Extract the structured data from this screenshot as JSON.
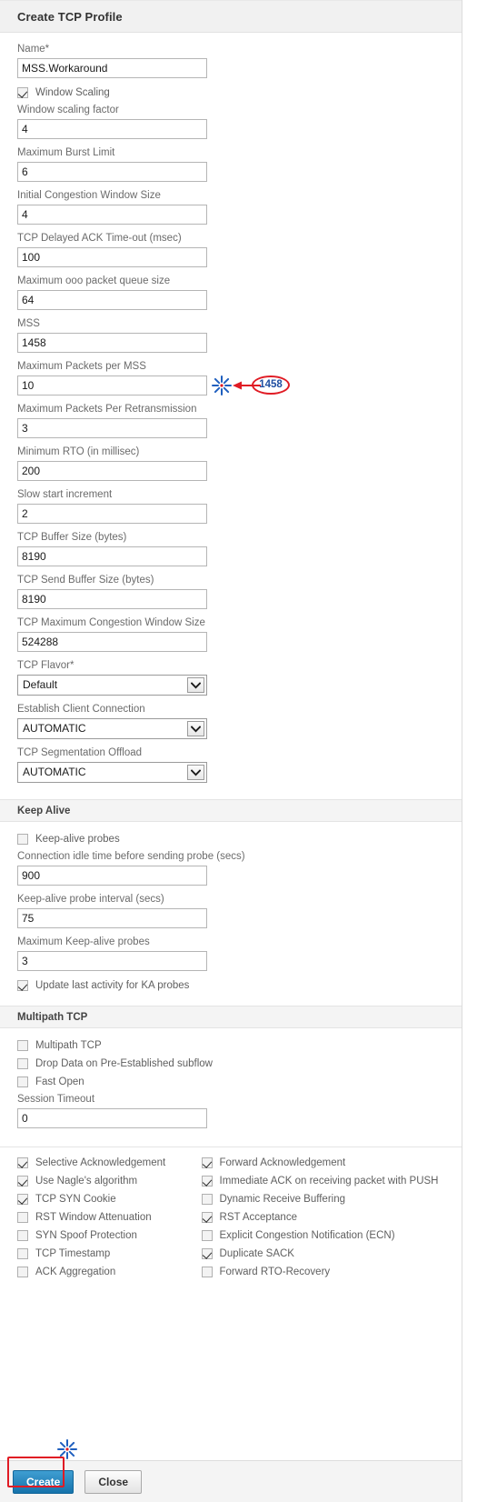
{
  "dialog": {
    "title": "Create TCP Profile"
  },
  "fields": {
    "name": {
      "label": "Name*",
      "value": "MSS.Workaround"
    },
    "window_scaling": {
      "label": "Window Scaling",
      "checked": true
    },
    "window_scaling_factor": {
      "label": "Window scaling factor",
      "value": "4"
    },
    "max_burst_limit": {
      "label": "Maximum Burst Limit",
      "value": "6"
    },
    "initial_cwnd": {
      "label": "Initial Congestion Window Size",
      "value": "4"
    },
    "delayed_ack": {
      "label": "TCP Delayed ACK Time-out (msec)",
      "value": "100"
    },
    "max_ooo_queue": {
      "label": "Maximum ooo packet queue size",
      "value": "64"
    },
    "mss": {
      "label": "MSS",
      "value": "1458"
    },
    "max_packets_per_mss": {
      "label": "Maximum Packets per MSS",
      "value": "10"
    },
    "max_packets_per_retx": {
      "label": "Maximum Packets Per Retransmission",
      "value": "3"
    },
    "min_rto": {
      "label": "Minimum RTO (in millisec)",
      "value": "200"
    },
    "slow_start_increment": {
      "label": "Slow start increment",
      "value": "2"
    },
    "tcp_buffer_size": {
      "label": "TCP Buffer Size (bytes)",
      "value": "8190"
    },
    "tcp_send_buffer_size": {
      "label": "TCP Send Buffer Size (bytes)",
      "value": "8190"
    },
    "tcp_max_cwnd": {
      "label": "TCP Maximum Congestion Window Size",
      "value": "524288"
    },
    "tcp_flavor": {
      "label": "TCP Flavor*",
      "value": "Default"
    },
    "establish_client_connection": {
      "label": "Establish Client Connection",
      "value": "AUTOMATIC"
    },
    "tcp_segmentation_offload": {
      "label": "TCP Segmentation Offload",
      "value": "AUTOMATIC"
    }
  },
  "keep_alive": {
    "band_title": "Keep Alive",
    "probes": {
      "label": "Keep-alive probes",
      "checked": false
    },
    "idle_time": {
      "label": "Connection idle time before sending probe (secs)",
      "value": "900"
    },
    "probe_interval": {
      "label": "Keep-alive probe interval (secs)",
      "value": "75"
    },
    "max_probes": {
      "label": "Maximum Keep-alive probes",
      "value": "3"
    },
    "update_last_activity": {
      "label": "Update last activity for KA probes",
      "checked": true
    }
  },
  "multipath": {
    "band_title": "Multipath TCP",
    "multipath_tcp": {
      "label": "Multipath TCP",
      "checked": false
    },
    "drop_data": {
      "label": "Drop Data on Pre-Established subflow",
      "checked": false
    },
    "fast_open": {
      "label": "Fast Open",
      "checked": false
    },
    "session_timeout": {
      "label": "Session Timeout",
      "value": "0"
    }
  },
  "options_grid": {
    "left": [
      {
        "label": "Selective Acknowledgement",
        "checked": true
      },
      {
        "label": "Use Nagle's algorithm",
        "checked": true
      },
      {
        "label": "TCP SYN Cookie",
        "checked": true
      },
      {
        "label": "RST Window Attenuation",
        "checked": false
      },
      {
        "label": "SYN Spoof Protection",
        "checked": false
      },
      {
        "label": "TCP Timestamp",
        "checked": false
      },
      {
        "label": "ACK Aggregation",
        "checked": false
      }
    ],
    "right": [
      {
        "label": "Forward Acknowledgement",
        "checked": true
      },
      {
        "label": "Immediate ACK on receiving packet with PUSH",
        "checked": true
      },
      {
        "label": "Dynamic Receive Buffering",
        "checked": false
      },
      {
        "label": "RST Acceptance",
        "checked": true
      },
      {
        "label": "Explicit Congestion Notification (ECN)",
        "checked": false
      },
      {
        "label": "Duplicate SACK",
        "checked": true
      },
      {
        "label": "Forward RTO-Recovery",
        "checked": false
      }
    ]
  },
  "footer": {
    "create_label": "Create",
    "close_label": "Close"
  },
  "annotations": {
    "mss_callout_text": "1458",
    "oval_color": "#e01b24",
    "callout_text_color": "#1f4ea1",
    "burst_color": "#1f5fbf",
    "arrow_color": "#e01b24",
    "highlight_color": "#e01b24"
  }
}
